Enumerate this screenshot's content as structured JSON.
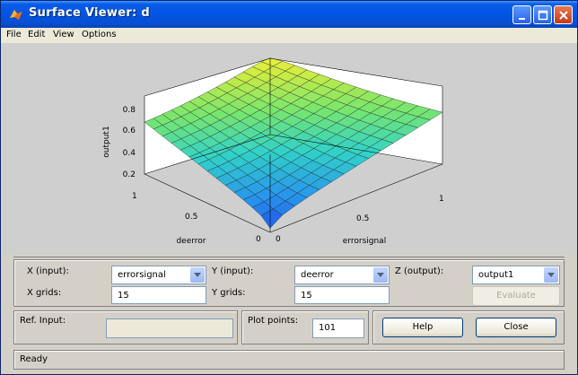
{
  "window": {
    "title": "Surface Viewer: d",
    "colors": {
      "titlebar": "#0054e3",
      "close_button": "#c8391b",
      "face": "#d4d0c8"
    }
  },
  "menu": [
    "File",
    "Edit",
    "View",
    "Options"
  ],
  "plot": {
    "zlabel": "output1",
    "xlabel": "deerror",
    "ylabel": "errorsignal",
    "z_ticks": [
      "0.8",
      "0.6",
      "0.4",
      "0.2"
    ],
    "x_ticks": [
      "1",
      "0.5",
      "0"
    ],
    "y_ticks": [
      "0",
      "0.5",
      "1"
    ],
    "grid_points": 15,
    "colormap": "parula-like blue to yellow"
  },
  "controls": {
    "x_input_label": "X (input):",
    "x_input_value": "errorsignal",
    "y_input_label": "Y (input):",
    "y_input_value": "deerror",
    "z_output_label": "Z (output):",
    "z_output_value": "output1",
    "x_grids_label": "X grids:",
    "x_grids_value": "15",
    "y_grids_label": "Y grids:",
    "y_grids_value": "15",
    "evaluate_label": "Evaluate",
    "ref_input_label": "Ref. Input:",
    "ref_input_value": "",
    "plot_points_label": "Plot points:",
    "plot_points_value": "101",
    "help_label": "Help",
    "close_label": "Close"
  },
  "status": "Ready"
}
